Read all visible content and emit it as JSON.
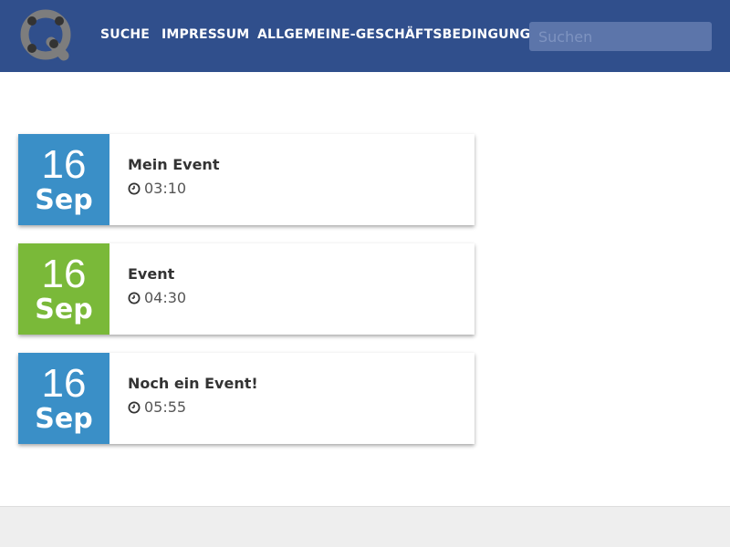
{
  "nav": {
    "logo_icon": "q-logo-icon",
    "links": [
      "SUCHE",
      "IMPRESSUM",
      "ALLGEMEINE-GESCHÄFTSBEDINGUNGEN"
    ],
    "search_placeholder": "Suchen"
  },
  "events": [
    {
      "day": "16",
      "month": "Sep",
      "title": "Mein Event",
      "time": "03:10",
      "color": "#3a8fc7"
    },
    {
      "day": "16",
      "month": "Sep",
      "title": "Event",
      "time": "04:30",
      "color": "#7ab939"
    },
    {
      "day": "16",
      "month": "Sep",
      "title": "Noch ein Event!",
      "time": "05:55",
      "color": "#3a8fc7"
    }
  ],
  "colors": {
    "navbar": "#304f8c",
    "footer": "#eeeeee"
  }
}
